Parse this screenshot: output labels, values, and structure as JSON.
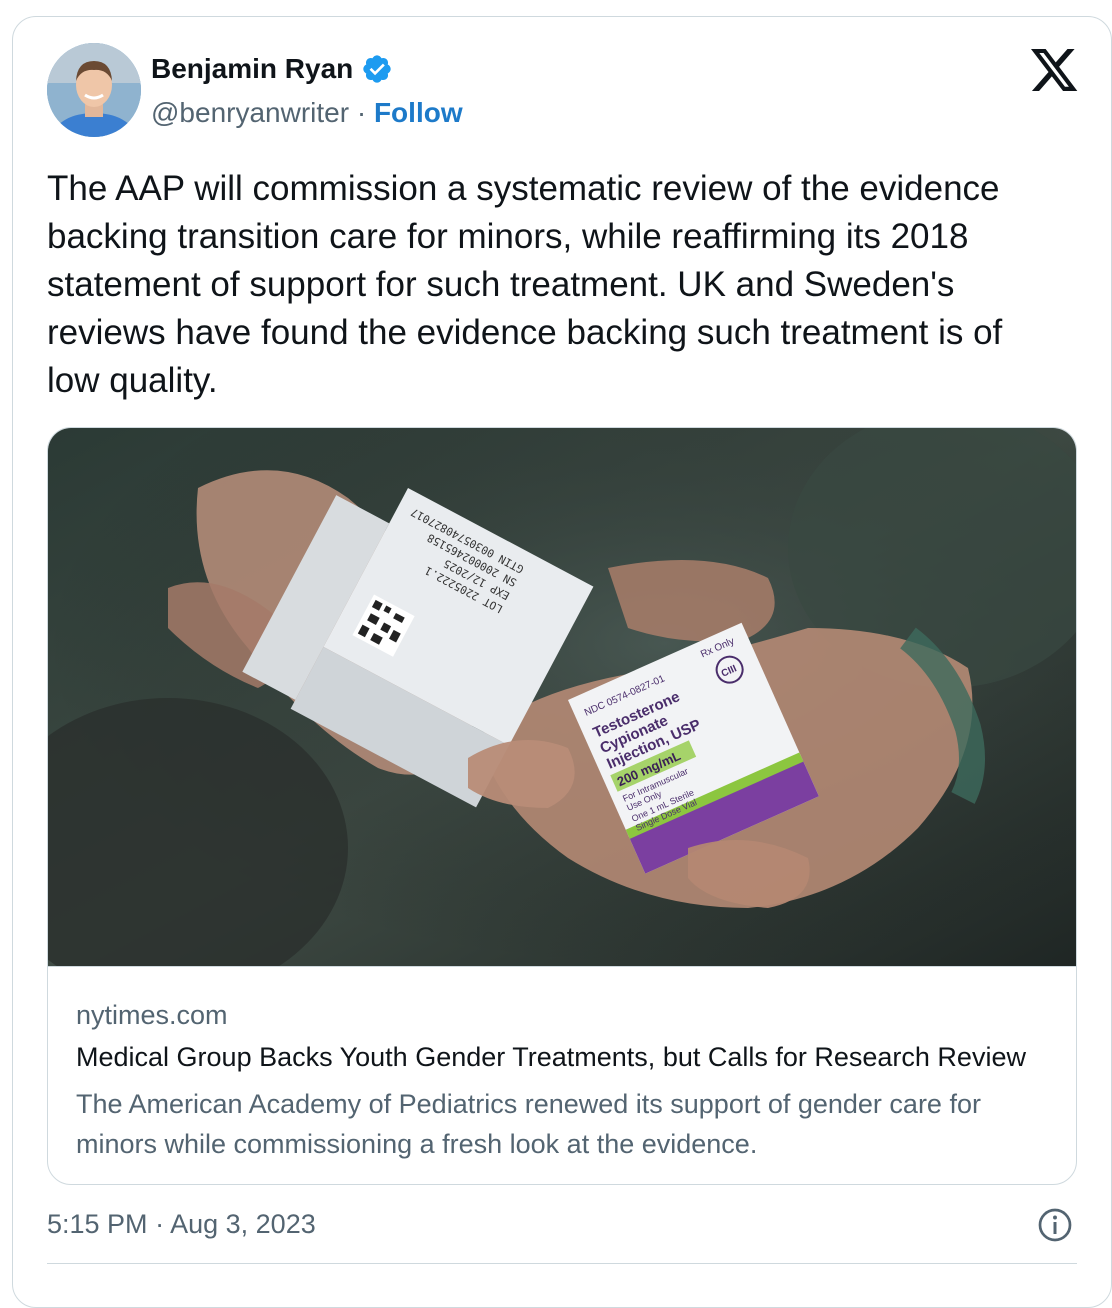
{
  "tweet": {
    "author_name": "Benjamin Ryan",
    "handle": "@benryanwriter",
    "separator": "·",
    "follow_label": "Follow",
    "text": "The AAP will commission a systematic review of the evidence backing transition care for minors, while reaffirming its 2018 statement of support for such treatment. UK and Sweden's reviews have found the evidence backing such treatment is of low quality.",
    "time": "5:15 PM",
    "date_separator": "·",
    "date": "Aug 3, 2023"
  },
  "link_card": {
    "domain": "nytimes.com",
    "headline": "Medical Group Backs Youth Gender Treatments, but Calls for Research Review",
    "description": "The American Academy of Pediatrics renewed its support of gender care for minors while commissioning a fresh look at the evidence.",
    "photo": {
      "box1_lines": [
        "LOT 2205222.1",
        "EXP 12/2025",
        "SN 200002465158",
        "GTIN 00305740827017"
      ],
      "box2_ndc": "NDC 0574-0827-01",
      "box2_rx": "Rx Only",
      "box2_logo": "CIII",
      "box2_name_lines": [
        "Testosterone",
        "Cypionate",
        "Injection, USP"
      ],
      "box2_strength": "200 mg/mL",
      "box2_route_lines": [
        "For Intramuscular",
        "Use Only"
      ],
      "box2_vial_lines": [
        "One 1 mL Sterile",
        "Single Dose Vial"
      ]
    }
  },
  "colors": {
    "follow": "#1d7ac9",
    "verified": "#1d9bf0",
    "secondary_text": "#536471",
    "border": "#cfd9de"
  },
  "icons": [
    "verified-badge-icon",
    "x-logo-icon",
    "info-icon"
  ]
}
